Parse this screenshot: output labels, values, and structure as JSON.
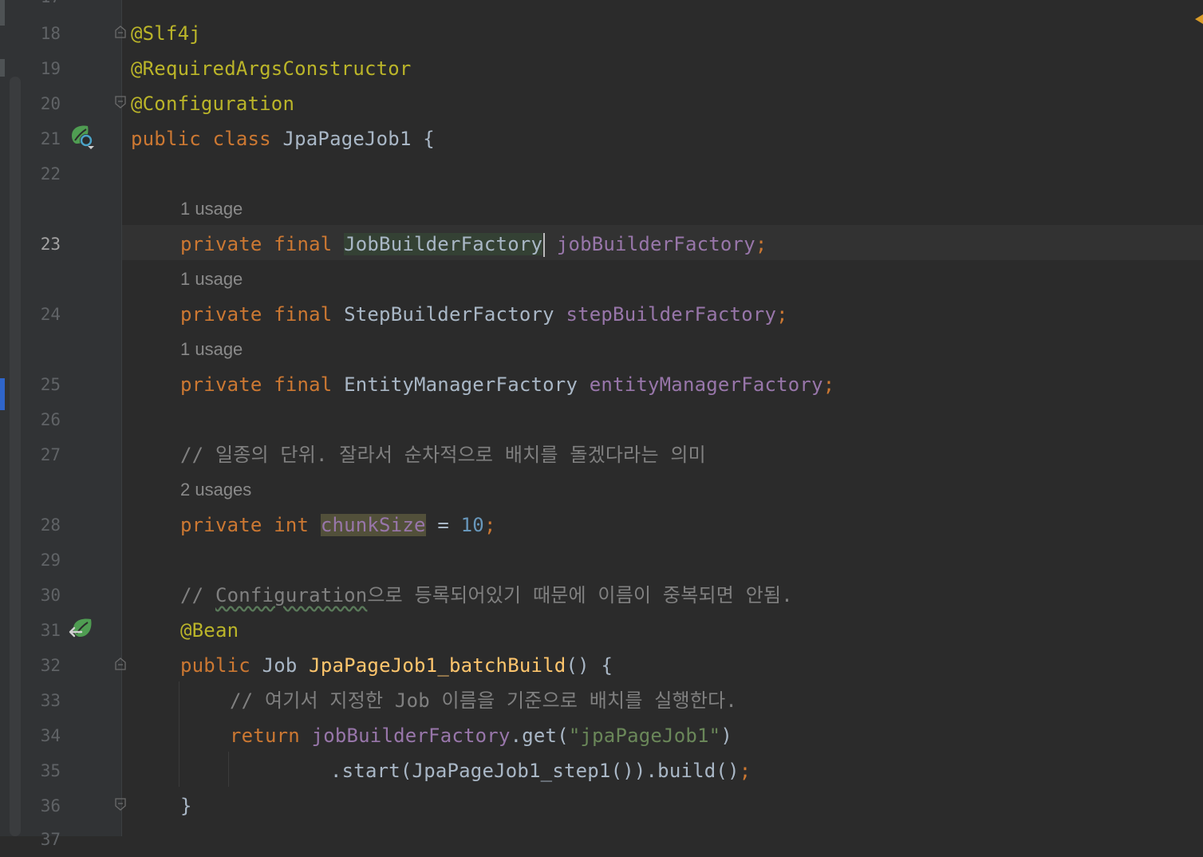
{
  "editor": {
    "current_line": "23",
    "lines": [
      {
        "num": "18",
        "text": "@Slf4j"
      },
      {
        "num": "19",
        "text": "@RequiredArgsConstructor"
      },
      {
        "num": "20",
        "text": "@Configuration"
      },
      {
        "num": "21",
        "kw1": "public",
        "kw2": "class",
        "name": "JpaPageJob1",
        "brace": "{"
      },
      {
        "num": "22"
      },
      {
        "num": "23",
        "kw1": "private",
        "kw2": "final",
        "type": "JobBuilderFactory",
        "field": "jobBuilderFactory",
        "semi": ";"
      },
      {
        "num": "24",
        "kw1": "private",
        "kw2": "final",
        "type": "StepBuilderFactory",
        "field": "stepBuilderFactory",
        "semi": ";"
      },
      {
        "num": "25",
        "kw1": "private",
        "kw2": "final",
        "type": "EntityManagerFactory",
        "field": "entityManagerFactory",
        "semi": ";"
      },
      {
        "num": "26"
      },
      {
        "num": "27",
        "comment": "// 일종의 단위. 잘라서 순차적으로 배치를 돌겠다라는 의미"
      },
      {
        "num": "28",
        "kw1": "private",
        "kw2": "int",
        "field": "chunkSize",
        "op": "=",
        "value": "10",
        "semi": ";"
      },
      {
        "num": "29"
      },
      {
        "num": "30",
        "comment_prefix": "// ",
        "comment_word": "Configuration",
        "comment_rest": "으로 등록되어있기 때문에 이름이 중복되면 안됨."
      },
      {
        "num": "31",
        "text": "@Bean"
      },
      {
        "num": "32",
        "kw1": "public",
        "type": "Job",
        "method": "JpaPageJob1_batchBuild",
        "paren": "()",
        "brace": "{"
      },
      {
        "num": "33",
        "comment": "// 여기서 지정한 Job 이름을 기준으로 배치를 실행한다."
      },
      {
        "num": "34",
        "kw1": "return",
        "field": "jobBuilderFactory",
        "call": ".get(",
        "str": "\"jpaPageJob1\"",
        "close": ")"
      },
      {
        "num": "35",
        "chain": ".start(JpaPageJob1_step1()).build()",
        "semi": ";"
      },
      {
        "num": "36",
        "brace": "}"
      }
    ],
    "usage_hints": [
      "1 usage",
      "1 usage",
      "1 usage",
      "2 usages"
    ]
  },
  "colors": {
    "background": "#2b2b2b",
    "gutter": "#313335",
    "keyword": "#cc7832",
    "annotation": "#bbb529",
    "field": "#9876aa",
    "method": "#ffc66d",
    "string": "#6a8759",
    "number": "#6897bb",
    "comment": "#808080"
  },
  "icons": [
    "spring-bean-config-icon",
    "spring-bean-method-icon",
    "fold-icon"
  ]
}
